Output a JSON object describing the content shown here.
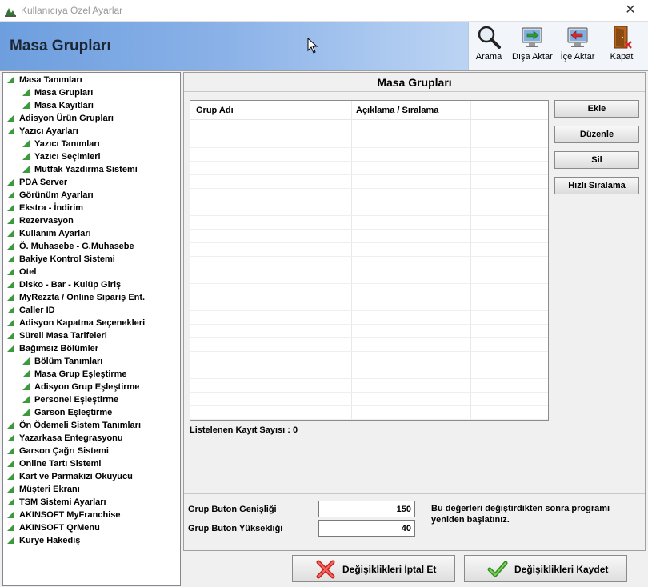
{
  "window": {
    "title": "Kullanıcıya Özel Ayarlar",
    "close_glyph": "✕"
  },
  "header": {
    "title": "Masa Grupları"
  },
  "toolbar": {
    "search_label": "Arama",
    "export_label": "Dışa Aktar",
    "import_label": "İçe Aktar",
    "close_label": "Kapat"
  },
  "tree": {
    "items": [
      {
        "label": "Masa Tanımları",
        "level": 0
      },
      {
        "label": "Masa Grupları",
        "level": 1
      },
      {
        "label": "Masa Kayıtları",
        "level": 1
      },
      {
        "label": "Adisyon Ürün Grupları",
        "level": 0
      },
      {
        "label": "Yazıcı Ayarları",
        "level": 0
      },
      {
        "label": "Yazıcı Tanımları",
        "level": 1
      },
      {
        "label": "Yazıcı Seçimleri",
        "level": 1
      },
      {
        "label": "Mutfak Yazdırma Sistemi",
        "level": 1
      },
      {
        "label": "PDA Server",
        "level": 0
      },
      {
        "label": "Görünüm Ayarları",
        "level": 0
      },
      {
        "label": "Ekstra - İndirim",
        "level": 0
      },
      {
        "label": "Rezervasyon",
        "level": 0
      },
      {
        "label": "Kullanım Ayarları",
        "level": 0
      },
      {
        "label": "Ö. Muhasebe - G.Muhasebe",
        "level": 0
      },
      {
        "label": "Bakiye Kontrol Sistemi",
        "level": 0
      },
      {
        "label": "Otel",
        "level": 0
      },
      {
        "label": "Disko - Bar - Kulüp Giriş",
        "level": 0
      },
      {
        "label": "MyRezzta / Online Sipariş Ent.",
        "level": 0
      },
      {
        "label": "Caller ID",
        "level": 0
      },
      {
        "label": "Adisyon Kapatma Seçenekleri",
        "level": 0
      },
      {
        "label": "Süreli Masa Tarifeleri",
        "level": 0
      },
      {
        "label": "Bağımsız Bölümler",
        "level": 0
      },
      {
        "label": "Bölüm Tanımları",
        "level": 1
      },
      {
        "label": "Masa Grup Eşleştirme",
        "level": 1
      },
      {
        "label": "Adisyon Grup Eşleştirme",
        "level": 1
      },
      {
        "label": "Personel Eşleştirme",
        "level": 1
      },
      {
        "label": "Garson Eşleştirme",
        "level": 1
      },
      {
        "label": "Ön Ödemeli Sistem Tanımları",
        "level": 0
      },
      {
        "label": "Yazarkasa Entegrasyonu",
        "level": 0
      },
      {
        "label": "Garson Çağrı Sistemi",
        "level": 0
      },
      {
        "label": "Online Tartı Sistemi",
        "level": 0
      },
      {
        "label": "Kart ve Parmakizi Okuyucu",
        "level": 0
      },
      {
        "label": "Müşteri Ekranı",
        "level": 0
      },
      {
        "label": "TSM Sistemi Ayarları",
        "level": 0
      },
      {
        "label": "AKINSOFT MyFranchise",
        "level": 0
      },
      {
        "label": "AKINSOFT QrMenu",
        "level": 0
      },
      {
        "label": "Kurye Hakediş",
        "level": 0
      }
    ]
  },
  "panel": {
    "title": "Masa Grupları",
    "columns": [
      "Grup Adı",
      "Açıklama / Sıralama"
    ],
    "rows": [],
    "buttons": {
      "add": "Ekle",
      "edit": "Düzenle",
      "delete": "Sil",
      "quick_sort": "Hızlı Sıralama"
    },
    "count_label": "Listelenen Kayıt Sayısı :",
    "count_value": "0"
  },
  "settings": {
    "width_label": "Grup Buton Genişliği",
    "width_value": "150",
    "height_label": "Grup Buton Yüksekliği",
    "height_value": "40",
    "note": "Bu değerleri değiştirdikten sonra programı yeniden başlatınız."
  },
  "footer": {
    "cancel_label": "Değişiklikleri İptal Et",
    "save_label": "Değişiklikleri Kaydet"
  }
}
